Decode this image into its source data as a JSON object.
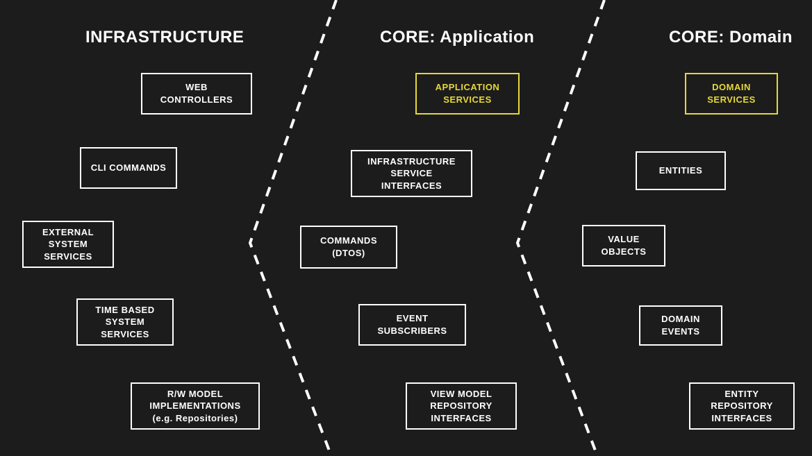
{
  "colors": {
    "background": "#1c1c1c",
    "box_border": "#ffffff",
    "box_text": "#ffffff",
    "accent": "#e6d83a",
    "divider": "#ffffff"
  },
  "columns": {
    "infrastructure": {
      "title": "INFRASTRUCTURE",
      "boxes": {
        "web_controllers": "WEB CONTROLLERS",
        "cli_commands": "CLI COMMANDS",
        "external_system_services": "EXTERNAL SYSTEM SERVICES",
        "time_based_system_services": "TIME BASED SYSTEM SERVICES",
        "rw_model_implementations": "R/W MODEL IMPLEMENTATIONS (e.g. Repositories)"
      }
    },
    "core_application": {
      "title": "CORE: Application",
      "boxes": {
        "application_services": "APPLICATION SERVICES",
        "infrastructure_service_interfaces": "INFRASTRUCTURE SERVICE INTERFACES",
        "commands_dtos": "COMMANDS (DTOS)",
        "event_subscribers": "EVENT SUBSCRIBERS",
        "view_model_repository_interfaces": "VIEW MODEL REPOSITORY INTERFACES"
      }
    },
    "core_domain": {
      "title": "CORE: Domain",
      "boxes": {
        "domain_services": "DOMAIN SERVICES",
        "entities": "ENTITIES",
        "value_objects": "VALUE OBJECTS",
        "domain_events": "DOMAIN EVENTS",
        "entity_repository_interfaces": "ENTITY REPOSITORY INTERFACES"
      }
    }
  }
}
